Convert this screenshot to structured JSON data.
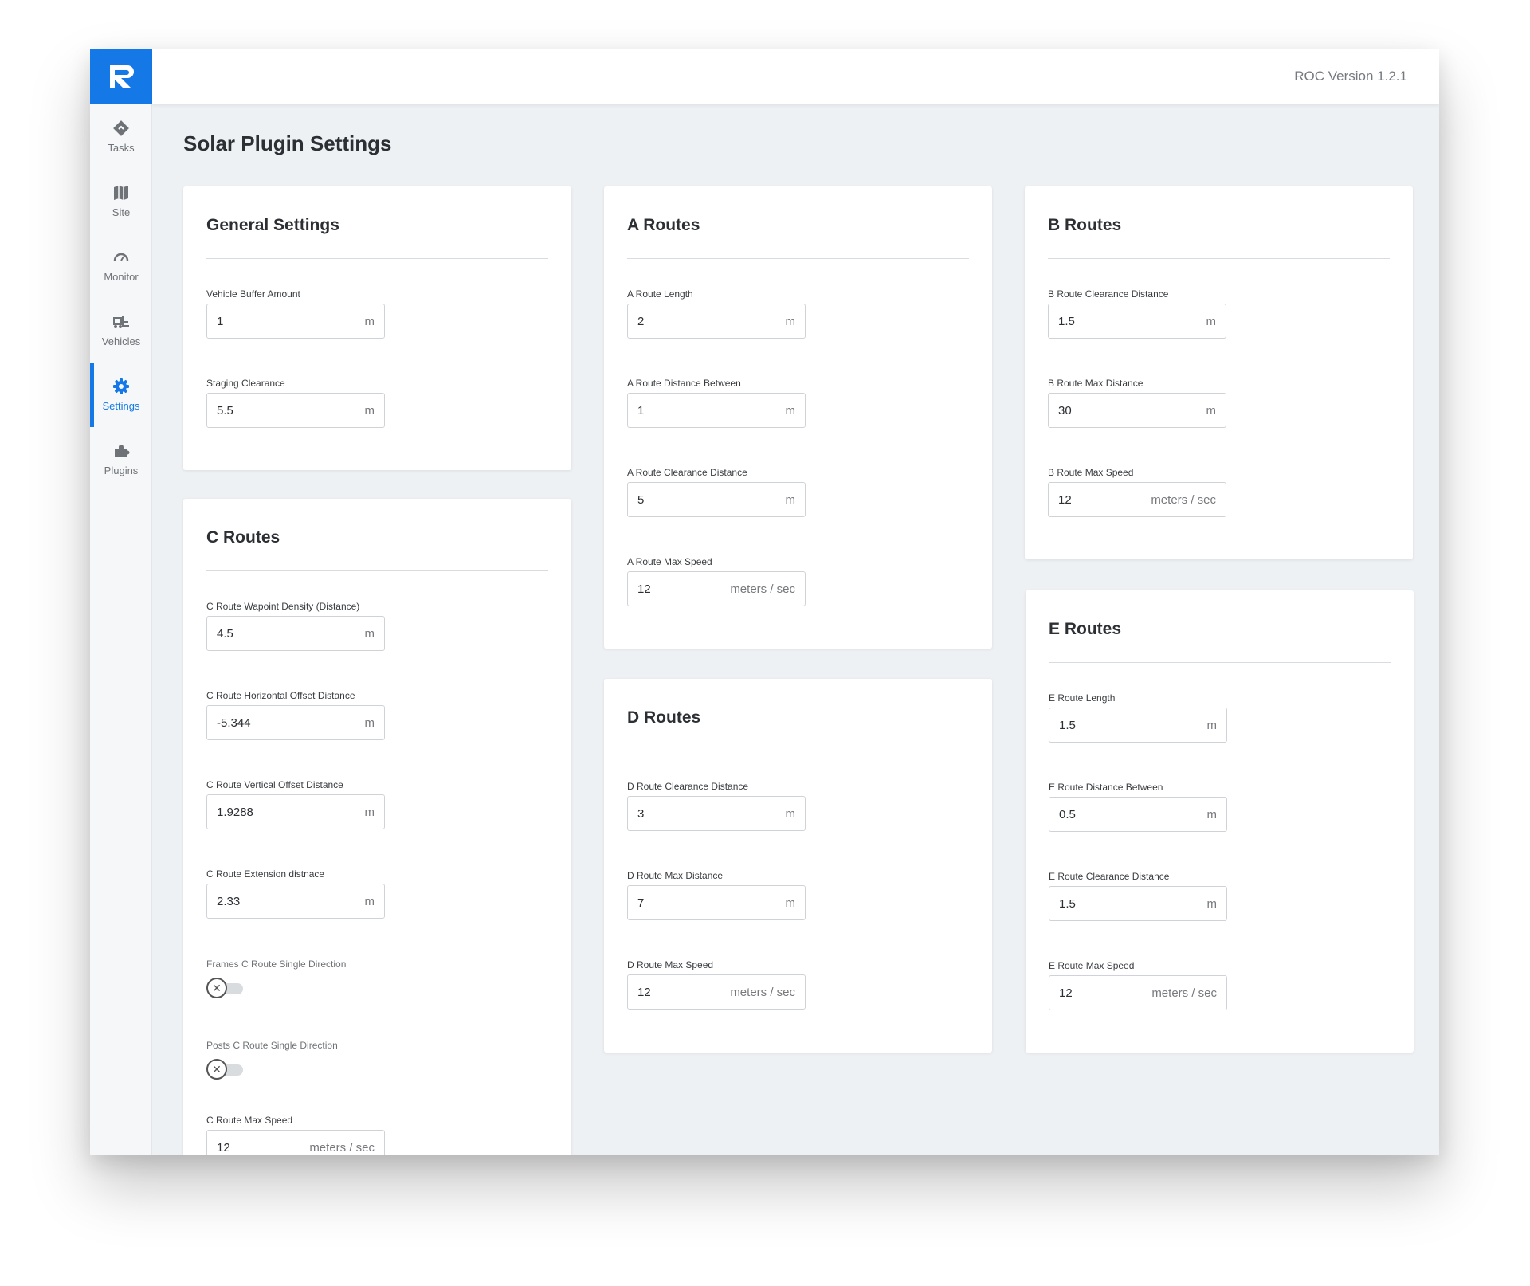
{
  "app": {
    "version": "ROC Version 1.2.1"
  },
  "nav": [
    {
      "id": "tasks",
      "label": "Tasks",
      "icon": "tasks-icon",
      "active": false
    },
    {
      "id": "site",
      "label": "Site",
      "icon": "map-icon",
      "active": false
    },
    {
      "id": "monitor",
      "label": "Monitor",
      "icon": "gauge-icon",
      "active": false
    },
    {
      "id": "vehicles",
      "label": "Vehicles",
      "icon": "forklift-icon",
      "active": false
    },
    {
      "id": "settings",
      "label": "Settings",
      "icon": "gear-icon",
      "active": true
    },
    {
      "id": "plugins",
      "label": "Plugins",
      "icon": "puzzle-icon",
      "active": false
    }
  ],
  "page": {
    "title": "Solar Plugin Settings"
  },
  "general": {
    "title": "General Settings",
    "fields": [
      {
        "label": "Vehicle Buffer Amount",
        "value": "1",
        "unit": "m"
      },
      {
        "label": "Staging Clearance",
        "value": "5.5",
        "unit": "m"
      }
    ]
  },
  "c_routes": {
    "title": "C Routes",
    "fields": [
      {
        "label": "C Route Wapoint Density (Distance)",
        "value": "4.5",
        "unit": "m"
      },
      {
        "label": "C Route Horizontal Offset Distance",
        "value": "-5.344",
        "unit": "m"
      },
      {
        "label": "C Route Vertical Offset Distance",
        "value": "1.9288",
        "unit": "m"
      },
      {
        "label": "C Route Extension distnace",
        "value": "2.33",
        "unit": "m"
      }
    ],
    "toggles": [
      {
        "label": "Frames C Route Single Direction",
        "on": false,
        "knob_glyph": "✕"
      },
      {
        "label": "Posts C Route Single Direction",
        "on": false,
        "knob_glyph": "✕"
      }
    ],
    "max_speed": {
      "label": "C Route Max Speed",
      "value": "12",
      "unit": "meters / sec"
    }
  },
  "a_routes": {
    "title": "A Routes",
    "fields": [
      {
        "label": "A Route Length",
        "value": "2",
        "unit": "m"
      },
      {
        "label": "A Route Distance Between",
        "value": "1",
        "unit": "m"
      },
      {
        "label": "A Route Clearance Distance",
        "value": "5",
        "unit": "m"
      },
      {
        "label": "A Route Max Speed",
        "value": "12",
        "unit": "meters / sec"
      }
    ]
  },
  "d_routes": {
    "title": "D Routes",
    "fields": [
      {
        "label": "D Route Clearance Distance",
        "value": "3",
        "unit": "m"
      },
      {
        "label": "D Route Max Distance",
        "value": "7",
        "unit": "m"
      },
      {
        "label": "D Route Max Speed",
        "value": "12",
        "unit": "meters / sec"
      }
    ]
  },
  "b_routes": {
    "title": "B Routes",
    "fields": [
      {
        "label": "B Route Clearance Distance",
        "value": "1.5",
        "unit": "m"
      },
      {
        "label": "B Route Max Distance",
        "value": "30",
        "unit": "m"
      },
      {
        "label": "B Route Max Speed",
        "value": "12",
        "unit": "meters / sec"
      }
    ]
  },
  "e_routes": {
    "title": "E Routes",
    "fields": [
      {
        "label": "E Route Length",
        "value": "1.5",
        "unit": "m"
      },
      {
        "label": "E Route Distance Between",
        "value": "0.5",
        "unit": "m"
      },
      {
        "label": "E Route Clearance Distance",
        "value": "1.5",
        "unit": "m"
      },
      {
        "label": "E Route Max Speed",
        "value": "12",
        "unit": "meters / sec"
      }
    ]
  },
  "colors": {
    "accent": "#1478e6",
    "background": "#eef1f4"
  }
}
